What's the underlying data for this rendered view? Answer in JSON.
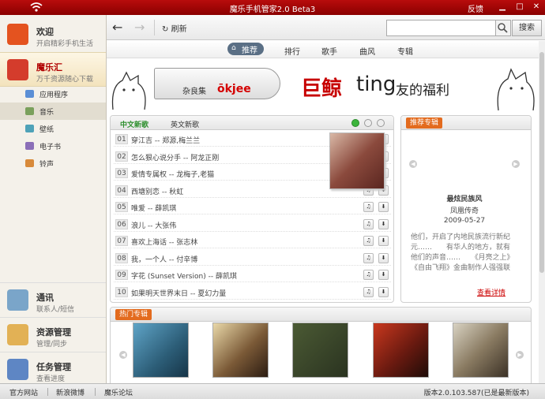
{
  "titlebar": {
    "title": "魔乐手机管家2.0 Beta3",
    "feedback": "反馈",
    "min": "▁",
    "max": "□",
    "close": "✕"
  },
  "sidebar": {
    "top": [
      {
        "title": "欢迎",
        "subtitle": "开启精彩手机生活",
        "icon": "fox-icon"
      },
      {
        "title": "魔乐汇",
        "subtitle": "万千资源随心下载",
        "icon": "store-icon"
      }
    ],
    "subitems": [
      "应用程序",
      "音乐",
      "壁纸",
      "电子书",
      "铃声"
    ],
    "bottom": [
      {
        "title": "通讯",
        "subtitle": "联系人/短信",
        "icon": "contacts-icon"
      },
      {
        "title": "资源管理",
        "subtitle": "管理/同步",
        "icon": "folder-icon"
      },
      {
        "title": "任务管理",
        "subtitle": "查看进度",
        "icon": "tasks-icon"
      }
    ]
  },
  "toolbar": {
    "refresh": "刷新",
    "search_placeholder": "",
    "search_label": "搜索"
  },
  "tabs": [
    "推荐",
    "排行",
    "歌手",
    "曲风",
    "专辑"
  ],
  "banner": {
    "brand1": "杂良集",
    "brand2": "ōkjee",
    "big": "巨鲸",
    "ting": "ting",
    "tail": "友的福利"
  },
  "songs": {
    "tab_cn": "中文新歌",
    "tab_en": "英文新歌",
    "rows": [
      {
        "n": "01",
        "t": "穿江吉 -- 郑源,梅兰兰"
      },
      {
        "n": "02",
        "t": "怎么狠心说分手 -- 阿龙正刚"
      },
      {
        "n": "03",
        "t": "爱情专属权 -- 龙梅子,老猫"
      },
      {
        "n": "04",
        "t": "西塘别恋 -- 秋虹"
      },
      {
        "n": "05",
        "t": "唯爱 -- 薛凯琪"
      },
      {
        "n": "06",
        "t": "浪儿 -- 大张伟"
      },
      {
        "n": "07",
        "t": "喜欢上海话 -- 张志林"
      },
      {
        "n": "08",
        "t": "我，一个人 -- 付辛博"
      },
      {
        "n": "09",
        "t": "字花 (Sunset Version) -- 薛凯琪"
      },
      {
        "n": "10",
        "t": "如果明天世界末日 -- 夏幻力量"
      }
    ]
  },
  "recommend": {
    "tag": "推荐专辑",
    "album_title": "最炫民族风",
    "artist": "凤凰传奇",
    "date": "2009-05-27",
    "desc": "他们，开启了内地民族流行新纪元……　　有华人的地方，就有他们的声音……　　《月亮之上》《自由飞翔》金曲制作人强强联",
    "detail": "查看详情"
  },
  "hot": {
    "tag": "热门专辑"
  },
  "footer": {
    "links": [
      "官方网站",
      "新浪微博",
      "魔乐论坛"
    ],
    "version": "版本2.0.103.587(已是最新版本)"
  }
}
